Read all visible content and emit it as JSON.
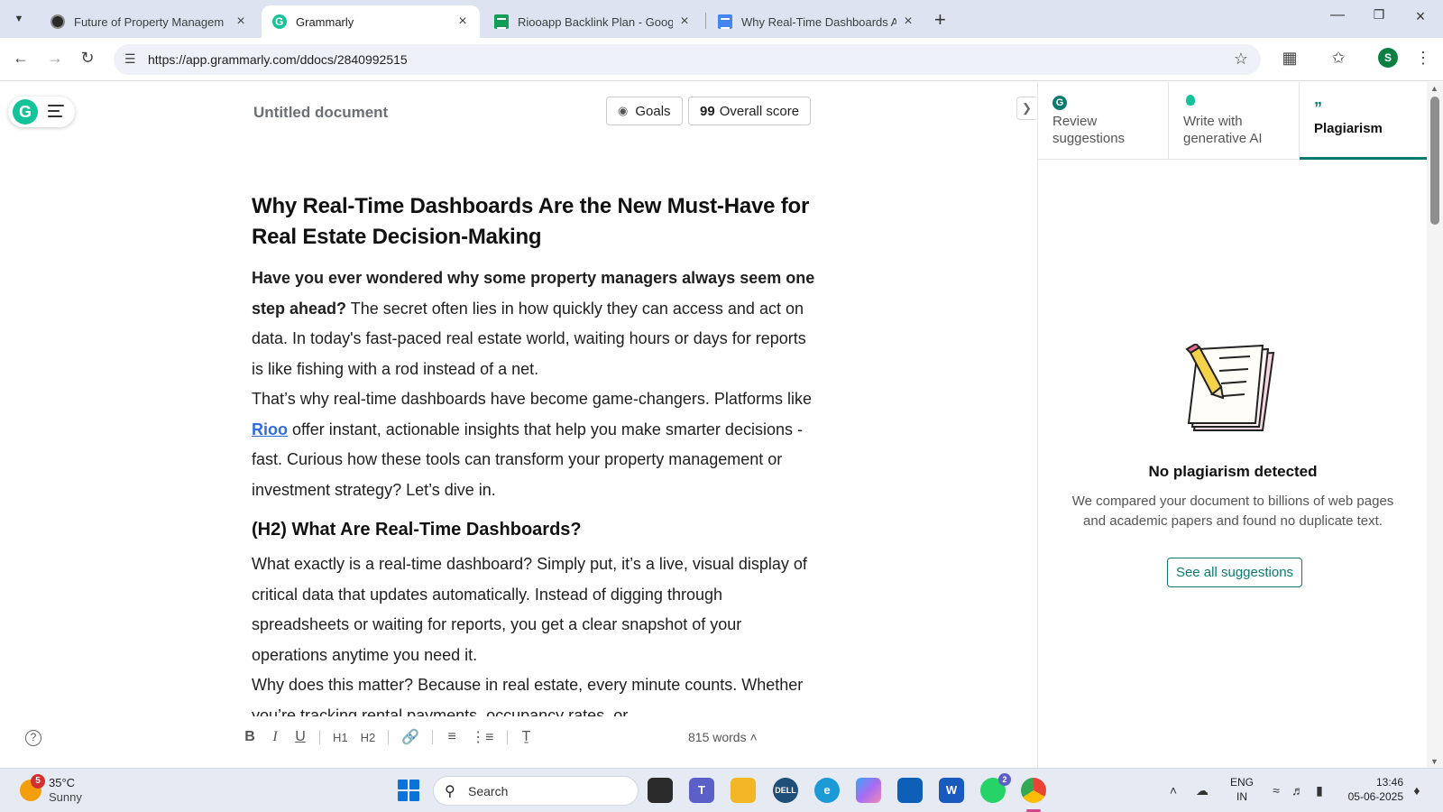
{
  "browser": {
    "tabs": [
      {
        "title": "Future of Property Managem"
      },
      {
        "title": "Grammarly"
      },
      {
        "title": "Riooapp Backlink Plan - Google"
      },
      {
        "title": "Why Real-Time Dashboards Are"
      }
    ],
    "url": "https://app.grammarly.com/ddocs/2840992515",
    "profile_initial": "S"
  },
  "editor": {
    "doc_title": "Untitled document",
    "goals_label": "Goals",
    "score_value": "99",
    "score_label": "Overall score",
    "word_count": "815 words",
    "heading1": "Why Real-Time Dashboards Are the New Must-Have for Real Estate Decision-Making",
    "p1_bold": "Have you ever wondered why some property managers always seem one step ahead?",
    "p1_rest": " The secret often lies in how quickly they can access and act on data. In today's fast-paced real estate world, waiting hours or days for reports is like fishing with a rod instead of a net.",
    "p2_before": "That’s why real-time dashboards have become game-changers. Platforms like ",
    "p2_link": "Rioo",
    "p2_after": " offer instant, actionable insights that help you make smarter decisions - fast. Curious how these tools can transform your property management or investment strategy? Let’s dive in.",
    "heading2": "(H2) What Are Real-Time Dashboards?",
    "p3": "What exactly is a real-time dashboard? Simply put, it’s a live, visual display of critical data that updates automatically. Instead of digging through spreadsheets or waiting for reports, you get a clear snapshot of your operations anytime you need it.",
    "p4": "Why does this matter? Because in real estate, every minute counts. Whether you’re tracking rental payments, occupancy rates, or"
  },
  "toolbar": {
    "bold": "B",
    "italic": "I",
    "underline": "U",
    "h1": "H1",
    "h2": "H2"
  },
  "panel": {
    "tabs": [
      {
        "label": "Review suggestions"
      },
      {
        "label": "Write with generative AI"
      },
      {
        "label": "Plagiarism"
      }
    ],
    "result_title": "No plagiarism detected",
    "result_desc": "We compared your document to billions of web pages and academic papers and found no duplicate text.",
    "see_all": "See all suggestions"
  },
  "taskbar": {
    "weather_badge": "5",
    "temperature": "35°C",
    "condition": "Sunny",
    "search_label": "Search",
    "whatsapp_badge": "2",
    "lang_line1": "ENG",
    "lang_line2": "IN",
    "time": "13:46",
    "date": "05-06-2025"
  },
  "colors": {
    "grammarly_green": "#15c39a",
    "panel_accent": "#0b7a6e",
    "link_blue": "#2f6de1"
  }
}
